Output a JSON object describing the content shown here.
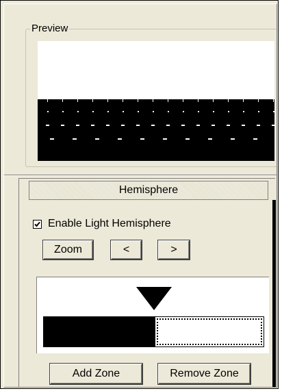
{
  "preview": {
    "label": "Preview"
  },
  "hemisphere": {
    "title": "Hemisphere",
    "enable_checkbox": {
      "label": "Enable Light Hemisphere",
      "checked": true
    },
    "buttons": {
      "zoom": "Zoom",
      "prev": "<",
      "next": ">"
    },
    "zone_editor": {
      "marker_icon": "triangle-down-icon",
      "zones": [
        {
          "fill": "#000000",
          "selected": false
        },
        {
          "fill": "#ffffff",
          "selected": true
        }
      ]
    },
    "actions": {
      "add_zone": "Add Zone",
      "remove_zone": "Remove Zone"
    }
  },
  "colors": {
    "panel_bg": "#ece9d8",
    "dark": "#000000",
    "light": "#ffffff"
  }
}
